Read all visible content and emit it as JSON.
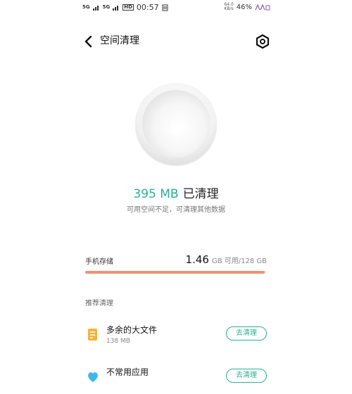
{
  "status_bar": {
    "signal1": "5G",
    "signal2": "5G",
    "hd": "HD",
    "time": "00:57",
    "speed_value": "64.0",
    "speed_unit": "KB/s",
    "battery": "46%"
  },
  "header": {
    "title": "空间清理"
  },
  "result": {
    "cleaned_amount": "395 MB",
    "cleaned_label": "已清理",
    "hint": "可用空间不足，可清理其他数据"
  },
  "storage": {
    "label": "手机存储",
    "available": "1.46",
    "available_unit": "GB 可用",
    "total": "128 GB",
    "used_fraction": 0.9886,
    "bar_color": "#ef9177"
  },
  "recommend": {
    "title": "推荐清理",
    "items": [
      {
        "name": "多余的大文件",
        "size": "138 MB",
        "button": "去清理",
        "icon": "file-icon",
        "icon_color": "#f2b43b"
      },
      {
        "name": "不常用应用",
        "button": "去清理",
        "icon": "heart-icon",
        "icon_color": "#3fb8e8"
      }
    ]
  },
  "colors": {
    "accent": "#2bae9a"
  }
}
